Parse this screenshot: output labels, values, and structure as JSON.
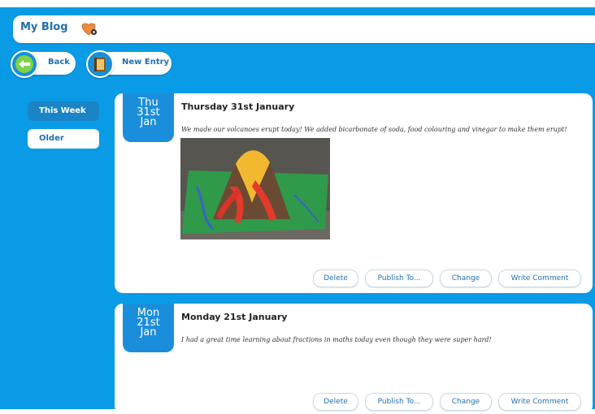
{
  "app": {
    "title": "My Blog"
  },
  "toolbar": {
    "back_label": "Back",
    "new_entry_label": "New Entry"
  },
  "sidebar": {
    "items": [
      {
        "label": "This Week",
        "active": true
      },
      {
        "label": "Older",
        "active": false
      }
    ]
  },
  "entries": [
    {
      "badge": {
        "day": "Thu",
        "date": "31st",
        "month": "Jan"
      },
      "title": "Thursday 31st January",
      "body": "We made our volcanoes erupt today! We added bicarbonate of soda, food colouring and vinegar to make them erupt!",
      "actions": [
        "Delete",
        "Publish To...",
        "Change",
        "Write Comment"
      ]
    },
    {
      "badge": {
        "day": "Mon",
        "date": "21st",
        "month": "Jan"
      },
      "title": "Monday 21st January",
      "body": "I had a great time learning about fractions in maths today even though they were super hard!",
      "actions": [
        "Delete",
        "Publish To...",
        "Change",
        "Write Comment"
      ]
    }
  ],
  "icons": {
    "title": "heart-icon",
    "back": "back-arrow-icon",
    "new_entry": "notebook-icon"
  },
  "colors": {
    "background": "#0a9be6",
    "accent": "#1b8edb",
    "text_link": "#1f6fae"
  }
}
